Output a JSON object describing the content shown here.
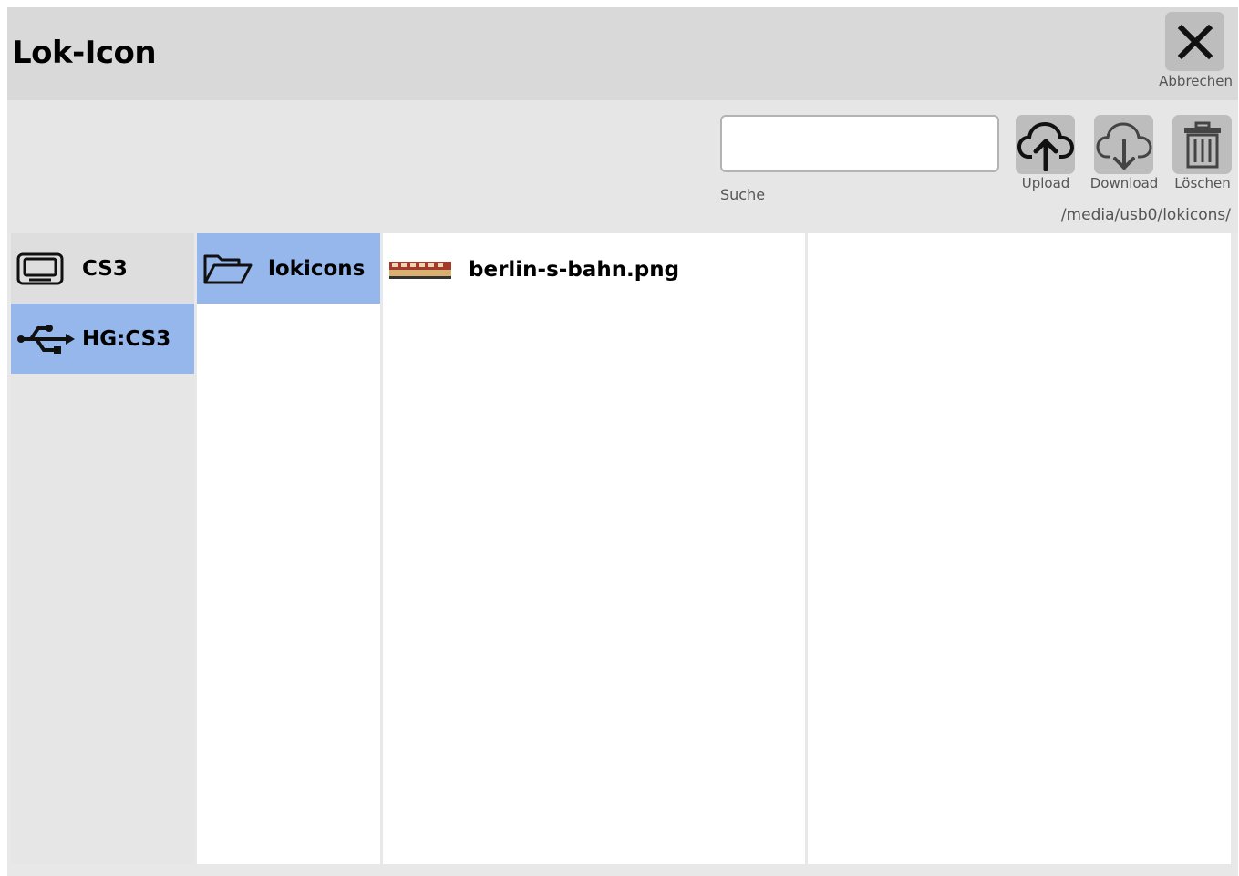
{
  "header": {
    "title": "Lok-Icon",
    "close_label": "Abbrechen"
  },
  "toolbar": {
    "search_value": "",
    "search_label": "Suche",
    "upload_label": "Upload",
    "download_label": "Download",
    "delete_label": "Löschen",
    "path": "/media/usb0/lokicons/"
  },
  "devices": [
    {
      "label": "CS3",
      "icon": "display-icon",
      "selected": false
    },
    {
      "label": "HG:CS3",
      "icon": "usb-icon",
      "selected": true
    }
  ],
  "folders": [
    {
      "label": "lokicons",
      "icon": "folder-open-icon",
      "selected": true
    }
  ],
  "files": [
    {
      "label": "berlin-s-bahn.png",
      "icon": "train-thumbnail"
    }
  ],
  "colors": {
    "selected": "#96b7ec",
    "button": "#bdbdbd",
    "header": "#d9d9d9"
  }
}
